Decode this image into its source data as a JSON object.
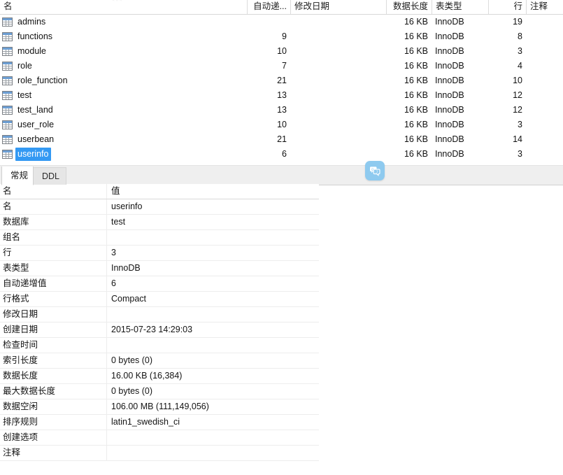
{
  "object_list": {
    "columns": [
      {
        "key": "name",
        "label": "名"
      },
      {
        "key": "auto_inc",
        "label": "自动递..."
      },
      {
        "key": "modified",
        "label": "修改日期"
      },
      {
        "key": "data_len",
        "label": "数据长度"
      },
      {
        "key": "engine",
        "label": "表类型"
      },
      {
        "key": "rows",
        "label": "行"
      },
      {
        "key": "comment",
        "label": "注释"
      }
    ],
    "rows": [
      {
        "name": "admins",
        "auto_inc": "",
        "modified": "",
        "data_len": "16 KB",
        "engine": "InnoDB",
        "rows": "19",
        "comment": "",
        "selected": false
      },
      {
        "name": "functions",
        "auto_inc": "9",
        "modified": "",
        "data_len": "16 KB",
        "engine": "InnoDB",
        "rows": "8",
        "comment": "",
        "selected": false
      },
      {
        "name": "module",
        "auto_inc": "10",
        "modified": "",
        "data_len": "16 KB",
        "engine": "InnoDB",
        "rows": "3",
        "comment": "",
        "selected": false
      },
      {
        "name": "role",
        "auto_inc": "7",
        "modified": "",
        "data_len": "16 KB",
        "engine": "InnoDB",
        "rows": "4",
        "comment": "",
        "selected": false
      },
      {
        "name": "role_function",
        "auto_inc": "21",
        "modified": "",
        "data_len": "16 KB",
        "engine": "InnoDB",
        "rows": "10",
        "comment": "",
        "selected": false
      },
      {
        "name": "test",
        "auto_inc": "13",
        "modified": "",
        "data_len": "16 KB",
        "engine": "InnoDB",
        "rows": "12",
        "comment": "",
        "selected": false
      },
      {
        "name": "test_land",
        "auto_inc": "13",
        "modified": "",
        "data_len": "16 KB",
        "engine": "InnoDB",
        "rows": "12",
        "comment": "",
        "selected": false
      },
      {
        "name": "user_role",
        "auto_inc": "10",
        "modified": "",
        "data_len": "16 KB",
        "engine": "InnoDB",
        "rows": "3",
        "comment": "",
        "selected": false
      },
      {
        "name": "userbean",
        "auto_inc": "21",
        "modified": "",
        "data_len": "16 KB",
        "engine": "InnoDB",
        "rows": "14",
        "comment": "",
        "selected": false
      },
      {
        "name": "userinfo",
        "auto_inc": "6",
        "modified": "",
        "data_len": "16 KB",
        "engine": "InnoDB",
        "rows": "3",
        "comment": "",
        "selected": true
      }
    ],
    "row_icon": "table-grid-icon"
  },
  "float_badge": {
    "icon": "translate-badge-icon",
    "color": "#8ecaef"
  },
  "info_panel": {
    "tabs": [
      {
        "label": "常规",
        "active": true
      },
      {
        "label": "DDL",
        "active": false
      }
    ],
    "properties_header": {
      "key": "名",
      "value": "值"
    },
    "properties": [
      {
        "key": "名",
        "value": "userinfo"
      },
      {
        "key": "数据库",
        "value": "test"
      },
      {
        "key": "组名",
        "value": ""
      },
      {
        "key": "行",
        "value": "3"
      },
      {
        "key": "表类型",
        "value": "InnoDB"
      },
      {
        "key": "自动递增值",
        "value": "6"
      },
      {
        "key": "行格式",
        "value": "Compact"
      },
      {
        "key": "修改日期",
        "value": ""
      },
      {
        "key": "创建日期",
        "value": "2015-07-23 14:29:03"
      },
      {
        "key": "检查时间",
        "value": ""
      },
      {
        "key": "索引长度",
        "value": "0 bytes (0)"
      },
      {
        "key": "数据长度",
        "value": "16.00 KB (16,384)"
      },
      {
        "key": "最大数据长度",
        "value": "0 bytes (0)"
      },
      {
        "key": "数据空闲",
        "value": "106.00 MB (111,149,056)"
      },
      {
        "key": "排序规则",
        "value": "latin1_swedish_ci"
      },
      {
        "key": "创建选项",
        "value": ""
      },
      {
        "key": "注释",
        "value": ""
      }
    ]
  },
  "colors": {
    "selection": "#3399f3",
    "tab_bar": "#efefef",
    "grid_line": "#ededed"
  }
}
